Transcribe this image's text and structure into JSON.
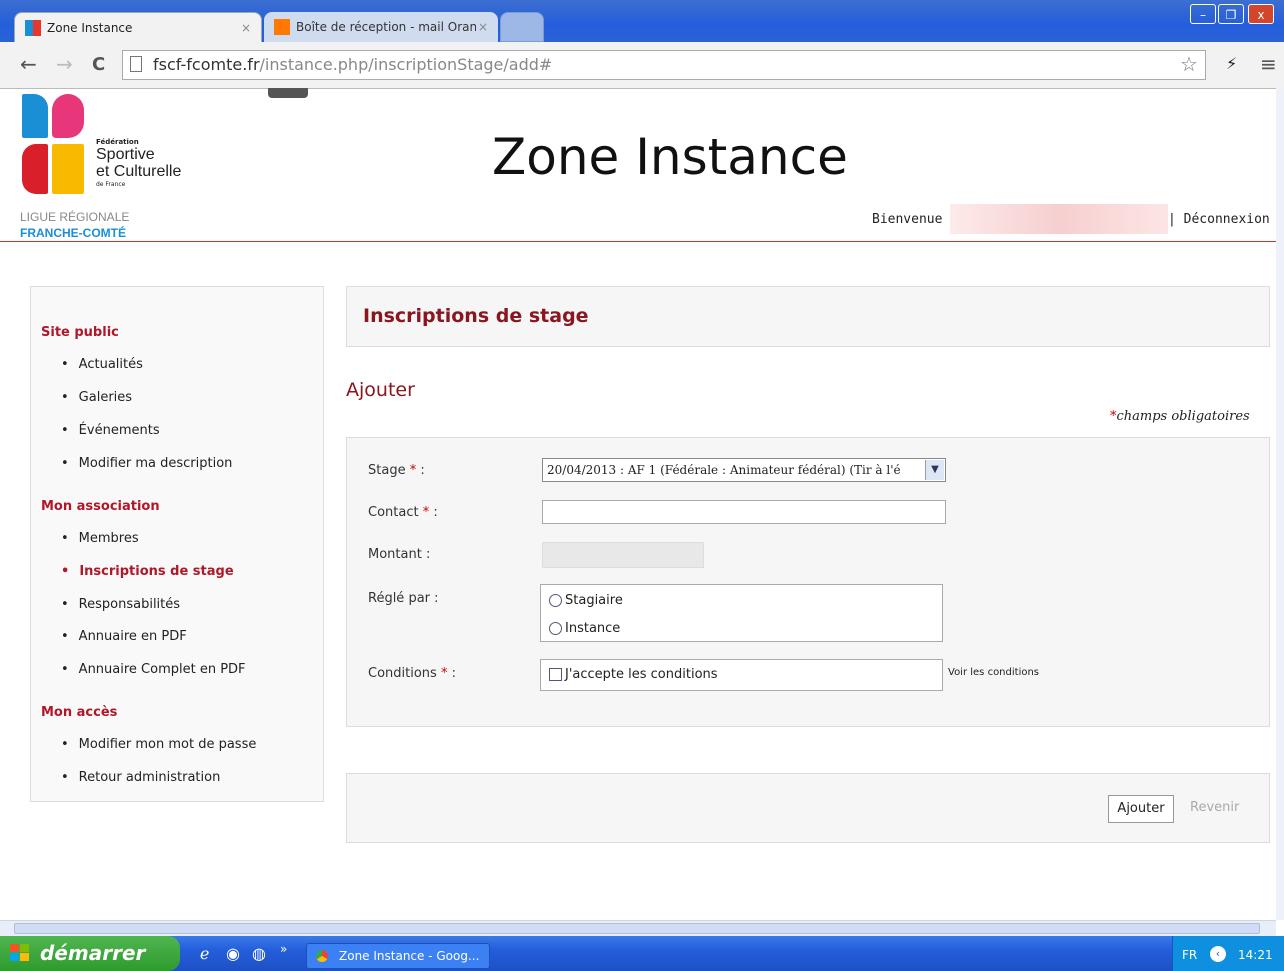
{
  "browser": {
    "tabs": [
      {
        "title": "Zone Instance",
        "close": "×"
      },
      {
        "title": "Boîte de réception - mail Oran",
        "close": "×"
      }
    ],
    "window_controls": {
      "minimize": "–",
      "maximize": "❐",
      "close": "x"
    },
    "nav": {
      "back": "←",
      "forward": "→",
      "reload": "C"
    },
    "url_domain": "fscf-fcomte.fr",
    "url_path": "/instance.php/inscriptionStage/add#",
    "star": "☆",
    "ext": "⚡",
    "menu": "≡"
  },
  "header": {
    "org_line1": "Fédération",
    "org_line2": "Sportive",
    "org_line3": "et Culturelle",
    "org_line4": "de France",
    "league_line1": "LIGUE RÉGIONALE",
    "league_line2": "FRANCHE-COMTÉ",
    "title": "Zone Instance",
    "welcome": "Bienvenue",
    "logout": "| Déconnexion"
  },
  "sidebar": {
    "sections": [
      {
        "title": "Site public",
        "items": [
          "Actualités",
          "Galeries",
          "Événements",
          "Modifier ma description"
        ]
      },
      {
        "title": "Mon association",
        "items": [
          "Membres",
          "Inscriptions de stage",
          "Responsabilités",
          "Annuaire en PDF",
          "Annuaire Complet en PDF"
        ]
      },
      {
        "title": "Mon accès",
        "items": [
          "Modifier mon mot de passe",
          "Retour administration"
        ]
      }
    ],
    "active_item": "Inscriptions de stage"
  },
  "main": {
    "heading": "Inscriptions de stage",
    "subheading": "Ajouter",
    "required_note": "champs obligatoires",
    "required_star": "*",
    "form": {
      "stage_label": "Stage",
      "stage_value": "20/04/2013 : AF 1 (Fédérale : Animateur fédéral) (Tir à l'é",
      "contact_label": "Contact",
      "amount_label": "Montant :",
      "paid_by_label": "Réglé par :",
      "paid_by_options": [
        "Stagiaire",
        "Instance"
      ],
      "conditions_label": "Conditions",
      "conditions_checkbox": "J'accepte les conditions",
      "conditions_link": "Voir les conditions",
      "colon": " :"
    },
    "buttons": {
      "add": "Ajouter",
      "back": "Revenir"
    }
  },
  "taskbar": {
    "start": "démarrer",
    "task": "Zone Instance - Goog...",
    "lang": "FR",
    "time": "14:21",
    "chevrons": "»"
  },
  "colors": {
    "accent_red": "#8a1620",
    "xp_blue": "#245edb",
    "xp_green": "#2e9b2e"
  }
}
